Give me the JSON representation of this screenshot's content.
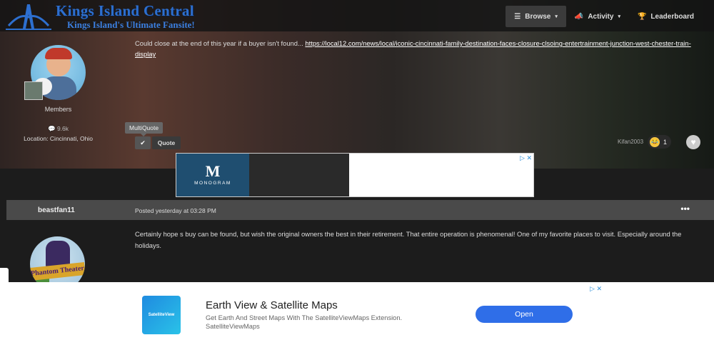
{
  "site": {
    "title": "Kings Island Central",
    "tagline": "Kings Island's Ultimate Fansite!"
  },
  "nav": [
    {
      "label": "Browse",
      "icon": "list-icon",
      "caret": "▾"
    },
    {
      "label": "Activity",
      "icon": "megaphone-icon",
      "caret": "▾"
    },
    {
      "label": "Leaderboard",
      "icon": "trophy-icon"
    }
  ],
  "post1": {
    "group": "Members",
    "count": "9.6k",
    "location": "Location: Cincinnati, Ohio",
    "text_prefix": "Could close at the end of this year if a buyer isn't found... ",
    "link": "https://local12.com/news/local/iconic-cincinnati-family-destination-faces-closure-clsoing-entertrainment-junction-west-chester-train-display",
    "tooltip": "MultiQuote",
    "quote_label": "Quote",
    "reactor": "Kifan2003",
    "reaction_count": "1"
  },
  "ad1": {
    "brand": "MONOGRAM",
    "brand_mark": "M",
    "choice": "▷ ✕"
  },
  "post2": {
    "author": "beastfan11",
    "date": "Posted yesterday at 03:28 PM",
    "more": "•••",
    "text": "Certainly hope s buy can be found, but wish the original owners the best in their retirement. That entire operation is phenomenal! One of my favorite places to visit. Especially around the holidays.",
    "avatar_sign": "Phantom Theater"
  },
  "bottom_ad": {
    "icon_text": "SatelliteView",
    "headline": "Earth View & Satellite Maps",
    "desc": "Get Earth And Street Maps With The SatelliteViewMaps Extension.",
    "source": "SatelliteViewMaps",
    "button": "Open",
    "choice": "▷ ✕"
  },
  "colors": {
    "accent_blue": "#2f6ee8",
    "logo_blue": "#2d6fcf",
    "header_bg": "#141414"
  }
}
